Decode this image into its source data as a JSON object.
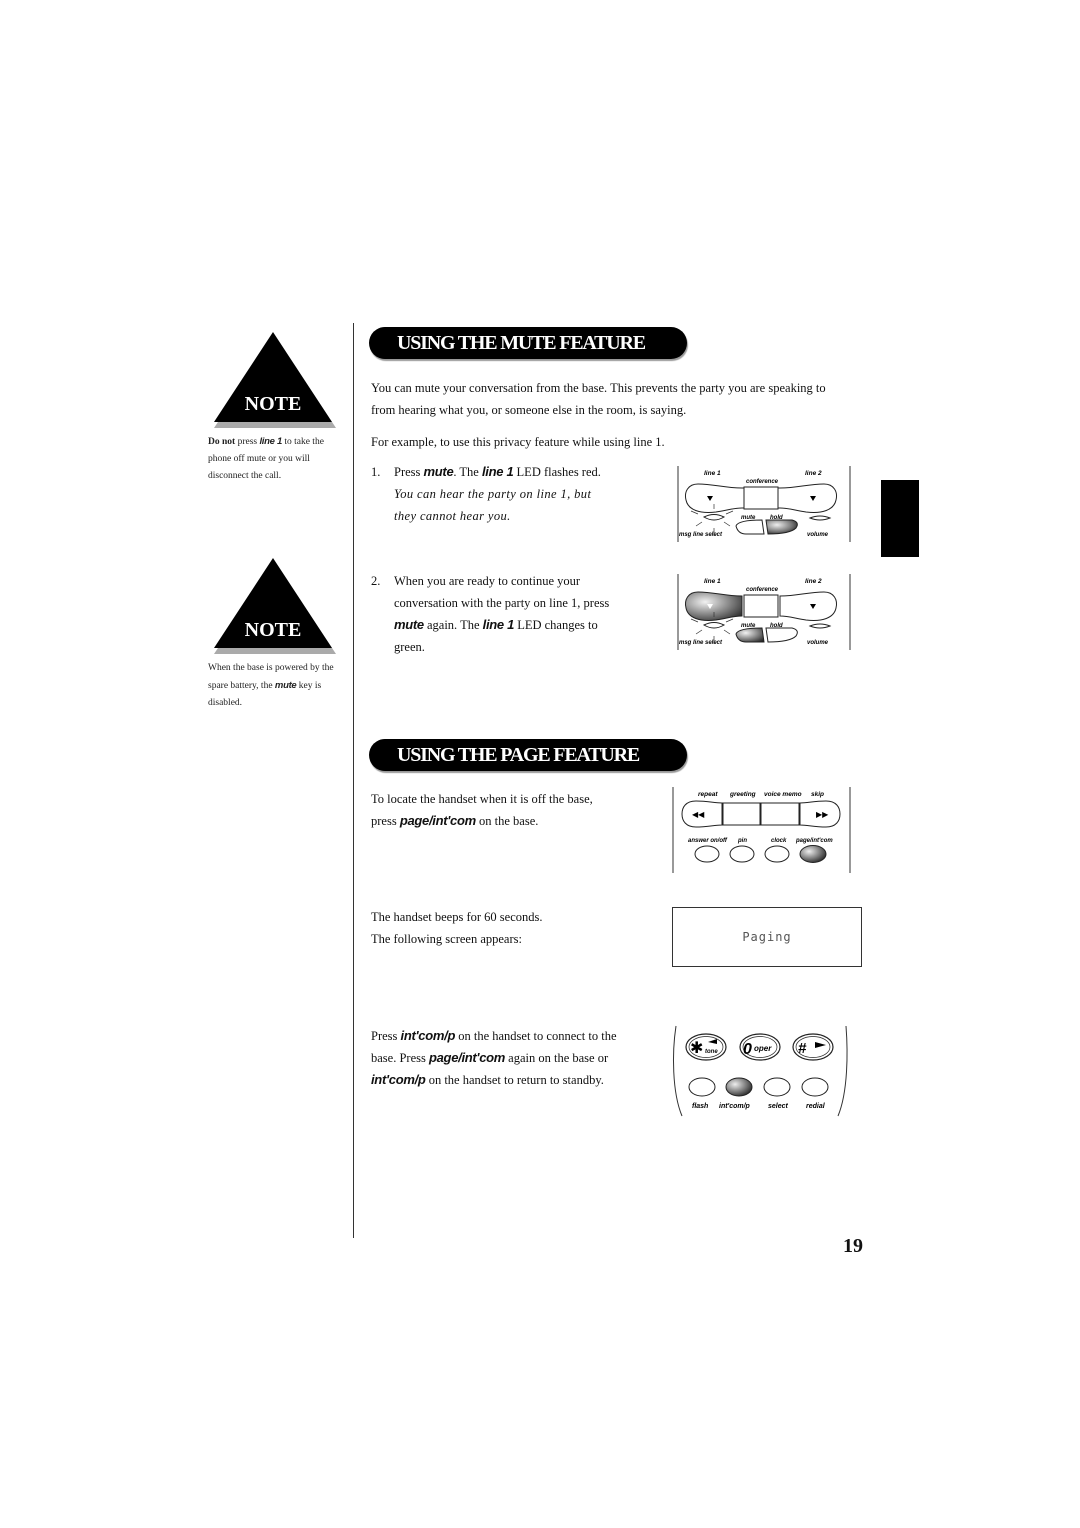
{
  "sidebar": {
    "note1": {
      "badge": "NOTE",
      "text_bold": "Do not",
      "text_pre": " press ",
      "keyword": "line 1",
      "text_post": " to take the phone off mute or you will disconnect the call."
    },
    "note2": {
      "badge": "NOTE",
      "text_pre": "When the base is powered by the spare battery, the ",
      "keyword": "mute",
      "text_post": " key is disabled."
    }
  },
  "mute_section": {
    "title": "USING THE MUTE FEATURE",
    "intro": "You can mute your conversation from the base. This prevents the party you are speaking to from hearing what you, or someone else in the room, is saying.",
    "example": "For example, to use this privacy feature while using line 1.",
    "steps": [
      {
        "num": "1.",
        "pre": "Press ",
        "kw1": "mute",
        "mid": ". The ",
        "kw2": "line 1",
        "post": " LED flashes red.",
        "italic": "You can hear the party on line 1, but they cannot hear you."
      },
      {
        "num": "2.",
        "pre": "When you are ready to continue your conversation with the party on line 1, press ",
        "kw1": "mute",
        "mid": " again. The ",
        "kw2": "line 1",
        "post": " LED changes to green."
      }
    ],
    "diagram_labels": {
      "line1": "line 1",
      "line2": "line 2",
      "conference": "conference",
      "mute": "mute",
      "hold": "hold",
      "msg_line_select": "msg line select",
      "volume": "volume"
    }
  },
  "page_section": {
    "title": "USING THE PAGE FEATURE",
    "para1_pre": "To locate the handset when it is off the base, press ",
    "para1_kw": "page/int'com",
    "para1_post": " on the base.",
    "para2_line1": "The handset beeps for 60 seconds.",
    "para2_line2": "The following screen appears:",
    "lcd_text": "Paging",
    "para3": {
      "p1": "Press ",
      "k1": "int'com/p",
      "p2": " on the handset to connect to the base. Press ",
      "k2": "page/int'com",
      "p3": " again on the base or ",
      "k3": "int'com/p",
      "p4": " on the handset to return to standby."
    },
    "base_labels": {
      "repeat": "repeat",
      "greeting": "greeting",
      "voice_memo": "voice memo",
      "skip": "skip",
      "answer": "answer on/off",
      "pin": "pin",
      "clock": "clock",
      "page": "page/int'com"
    },
    "handset_labels": {
      "star": "✱",
      "tone": "tone",
      "zero": "0",
      "oper": "oper",
      "hash": "#",
      "flash": "flash",
      "intcom": "int'com/p",
      "select": "select",
      "redial": "redial"
    }
  },
  "page_number": "19"
}
